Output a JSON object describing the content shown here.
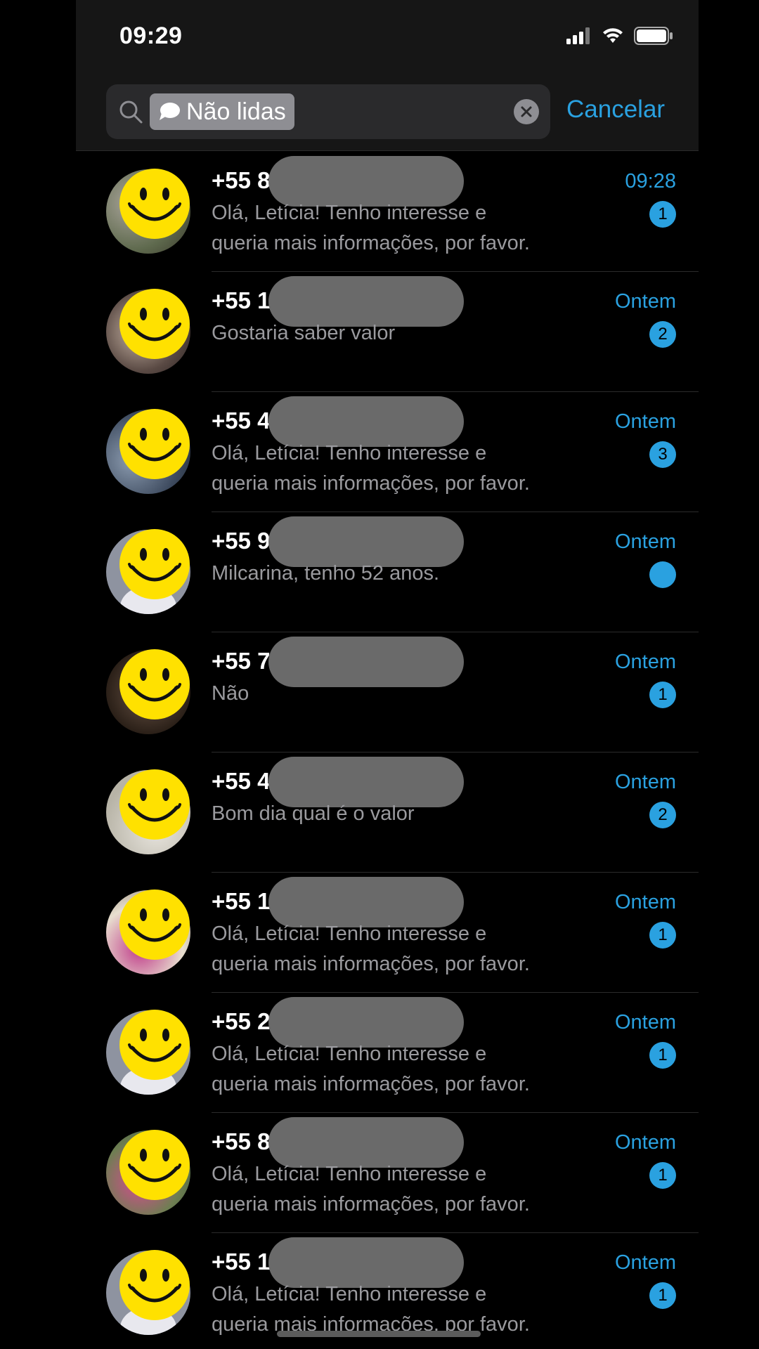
{
  "status_bar": {
    "time": "09:29"
  },
  "search": {
    "filter_chip": "Não lidas",
    "cancel_label": "Cancelar"
  },
  "chats": [
    {
      "name": "+55 8",
      "preview": "Olá, Letícia! Tenho interesse e queria mais informações, por favor.",
      "time": "09:28",
      "unread": "1",
      "avatar": "photo1"
    },
    {
      "name": "+55 1",
      "preview": "Gostaria saber valor",
      "time": "Ontem",
      "unread": "2",
      "avatar": "photo2"
    },
    {
      "name": "+55 4",
      "preview": "Olá, Letícia! Tenho interesse e queria mais informações, por favor.",
      "time": "Ontem",
      "unread": "3",
      "avatar": "photo3"
    },
    {
      "name": "+55 9",
      "preview": "Milcarina, tenho 52 anos.",
      "time": "Ontem",
      "unread": "",
      "avatar": "default"
    },
    {
      "name": "+55 7",
      "preview": "Não",
      "time": "Ontem",
      "unread": "1",
      "avatar": "photo4"
    },
    {
      "name": "+55 4",
      "preview": "Bom dia qual é o valor",
      "time": "Ontem",
      "unread": "2",
      "avatar": "photo5"
    },
    {
      "name": "+55 1",
      "preview": "Olá, Letícia! Tenho interesse e queria mais informações, por favor.",
      "time": "Ontem",
      "unread": "1",
      "avatar": "photo6"
    },
    {
      "name": "+55 2",
      "preview": "Olá, Letícia! Tenho interesse e queria mais informações, por favor.",
      "time": "Ontem",
      "unread": "1",
      "avatar": "default"
    },
    {
      "name": "+55 8",
      "preview": "Olá, Letícia! Tenho interesse e queria mais informações, por favor.",
      "time": "Ontem",
      "unread": "1",
      "avatar": "photo7"
    },
    {
      "name": "+55 11",
      "preview": "Olá, Letícia! Tenho interesse e queria mais informações, por favor.",
      "time": "Ontem",
      "unread": "1",
      "avatar": "default"
    }
  ],
  "colors": {
    "accent": "#2aa1e0",
    "background": "#000000",
    "redaction": "#6a6a6a",
    "smiley": "#ffe100"
  },
  "icons": [
    "signal-icon",
    "wifi-icon",
    "battery-icon",
    "search-icon",
    "chat-bubble-icon",
    "clear-icon",
    "smiley-icon"
  ]
}
